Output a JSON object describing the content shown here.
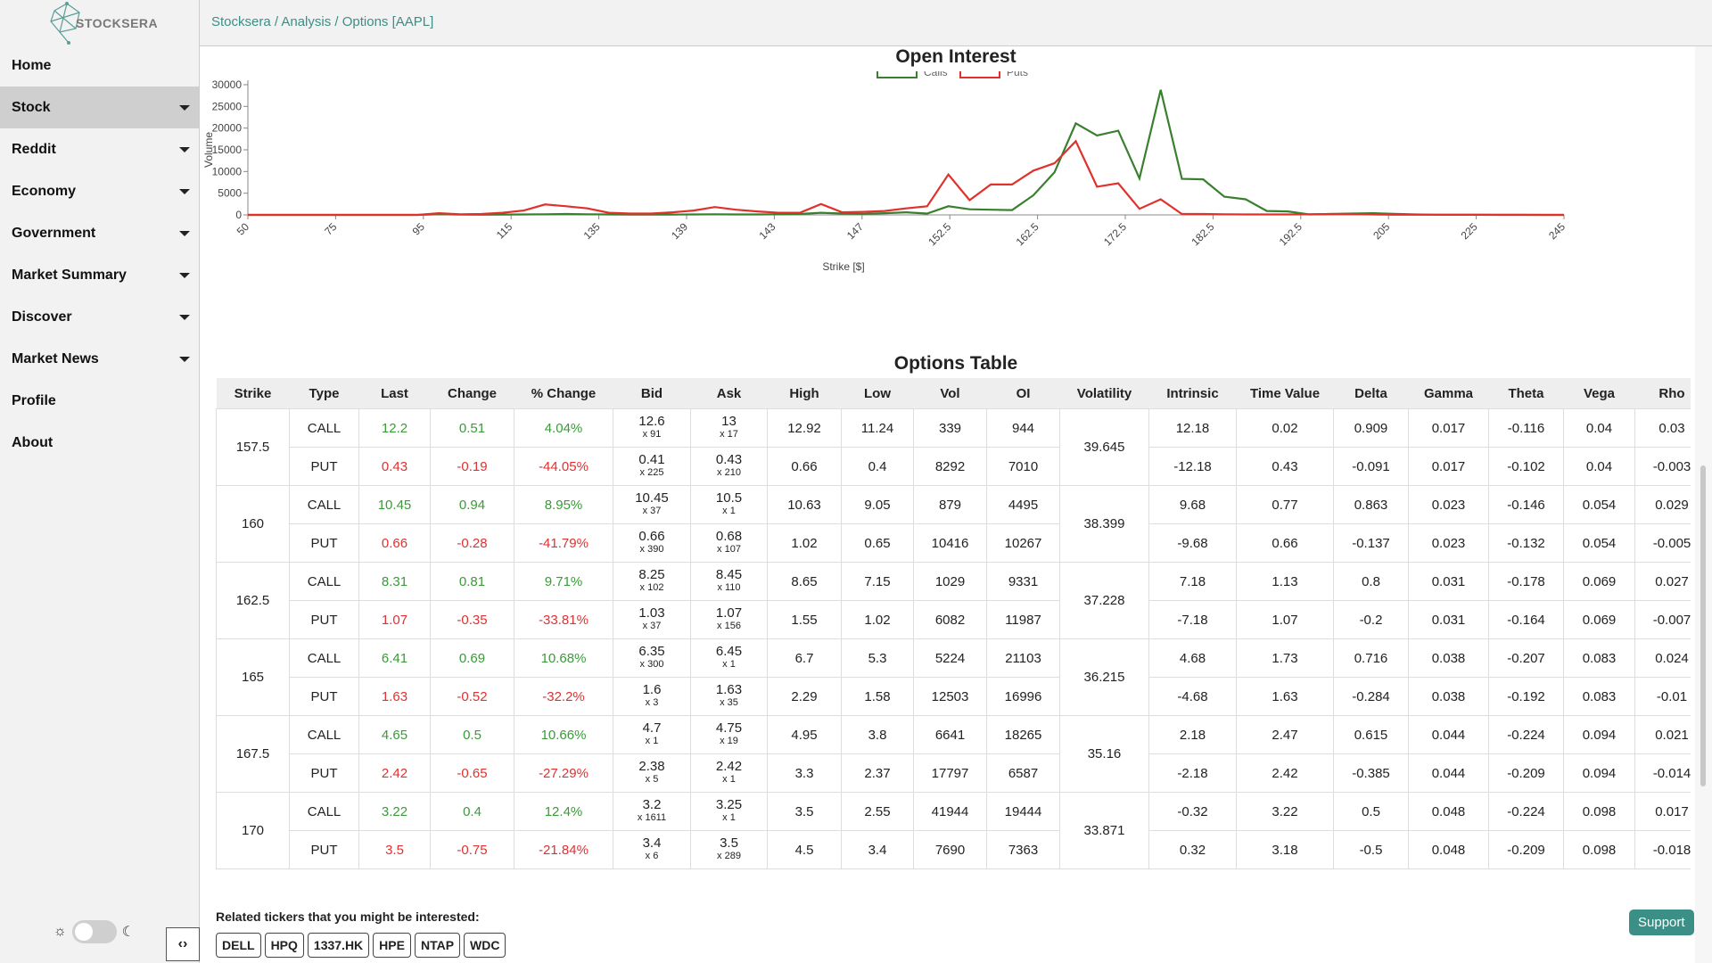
{
  "app": {
    "logo_text": "STOCKSERA",
    "accent_color": "#3a8f87"
  },
  "breadcrumb": "Stocksera / Analysis / Options [AAPL]",
  "nav": [
    {
      "label": "Home",
      "caret": false,
      "active": false
    },
    {
      "label": "Stock",
      "caret": true,
      "active": true
    },
    {
      "label": "Reddit",
      "caret": true,
      "active": false
    },
    {
      "label": "Economy",
      "caret": true,
      "active": false
    },
    {
      "label": "Government",
      "caret": true,
      "active": false
    },
    {
      "label": "Market Summary",
      "caret": true,
      "active": false
    },
    {
      "label": "Discover",
      "caret": true,
      "active": false
    },
    {
      "label": "Market News",
      "caret": true,
      "active": false
    },
    {
      "label": "Profile",
      "caret": false,
      "active": false
    },
    {
      "label": "About",
      "caret": false,
      "active": false
    }
  ],
  "icons": {
    "sun": "☼",
    "moon": "☾",
    "collapse": "‹›"
  },
  "chart": {
    "title": "Open Interest",
    "legend": [
      {
        "label": "Calls",
        "color": "#3a7f2f"
      },
      {
        "label": "Puts",
        "color": "#e0312b"
      }
    ],
    "xlabel": "Strike [$]",
    "ylabel": "Volume",
    "yticks": [
      "0",
      "5000",
      "10000",
      "15000",
      "20000",
      "25000",
      "30000"
    ],
    "xticks": [
      "50",
      "75",
      "95",
      "115",
      "135",
      "139",
      "143",
      "147",
      "152.5",
      "162.5",
      "172.5",
      "182.5",
      "192.5",
      "205",
      "225",
      "245"
    ]
  },
  "chart_data": {
    "type": "line",
    "title": "Open Interest",
    "xlabel": "Strike [$]",
    "ylabel": "Volume",
    "ylim": [
      0,
      30000
    ],
    "x": [
      "50",
      "55",
      "60",
      "65",
      "70",
      "75",
      "80",
      "85",
      "90",
      "95",
      "100",
      "105",
      "110",
      "115",
      "120",
      "125",
      "130",
      "135",
      "136",
      "137",
      "138",
      "139",
      "140",
      "141",
      "142",
      "143",
      "144",
      "145",
      "146",
      "147",
      "148",
      "149",
      "150",
      "152.5",
      "155",
      "157.5",
      "160",
      "162.5",
      "165",
      "167.5",
      "170",
      "172.5",
      "175",
      "177.5",
      "180",
      "182.5",
      "185",
      "187.5",
      "190",
      "192.5",
      "195",
      "197.5",
      "200",
      "205",
      "210",
      "215",
      "220",
      "225",
      "230",
      "235",
      "240",
      "245",
      "250"
    ],
    "series": [
      {
        "name": "Calls",
        "color": "#3a7f2f",
        "values": [
          0,
          0,
          0,
          0,
          0,
          0,
          0,
          0,
          0,
          150,
          80,
          50,
          80,
          100,
          150,
          200,
          150,
          100,
          80,
          80,
          80,
          100,
          150,
          100,
          100,
          150,
          200,
          500,
          300,
          250,
          400,
          600,
          300,
          2000,
          1300,
          1200,
          1100,
          4500,
          9800,
          21100,
          18300,
          19400,
          8400,
          28800,
          8300,
          8200,
          4200,
          3600,
          900,
          800,
          100,
          200,
          300,
          400,
          250,
          100,
          50,
          50,
          50,
          30,
          20,
          10,
          0
        ]
      },
      {
        "name": "Puts",
        "color": "#e0312b",
        "values": [
          0,
          0,
          0,
          0,
          0,
          0,
          0,
          0,
          0,
          400,
          150,
          200,
          500,
          1000,
          2400,
          2000,
          1500,
          500,
          300,
          300,
          600,
          1000,
          1800,
          1200,
          800,
          500,
          500,
          2500,
          600,
          700,
          900,
          1500,
          2000,
          9300,
          3400,
          7000,
          7000,
          10200,
          11900,
          17000,
          6500,
          7300,
          1400,
          3600,
          200,
          200,
          150,
          100,
          100,
          100,
          150,
          200,
          200,
          100,
          50,
          50,
          50,
          30,
          20,
          10,
          5,
          0,
          0
        ]
      }
    ]
  },
  "table": {
    "title": "Options Table",
    "columns": [
      "Strike",
      "Type",
      "Last",
      "Change",
      "% Change",
      "Bid",
      "Ask",
      "High",
      "Low",
      "Vol",
      "OI",
      "Volatility",
      "Intrinsic",
      "Time Value",
      "Delta",
      "Gamma",
      "Theta",
      "Vega",
      "Rho"
    ],
    "groups": [
      {
        "strike": "157.5",
        "volatility": "39.645",
        "rows": [
          {
            "type": "CALL",
            "last": "12.2",
            "change": "0.51",
            "pct": "4.04%",
            "bid": "12.6",
            "bid_size": "x 91",
            "ask": "13",
            "ask_size": "x 17",
            "high": "12.92",
            "low": "11.24",
            "vol": "339",
            "oi": "944",
            "intrinsic": "12.18",
            "time_value": "0.02",
            "delta": "0.909",
            "gamma": "0.017",
            "theta": "-0.116",
            "vega": "0.04",
            "rho": "0.03"
          },
          {
            "type": "PUT",
            "last": "0.43",
            "change": "-0.19",
            "pct": "-44.05%",
            "bid": "0.41",
            "bid_size": "x 225",
            "ask": "0.43",
            "ask_size": "x 210",
            "high": "0.66",
            "low": "0.4",
            "vol": "8292",
            "oi": "7010",
            "intrinsic": "-12.18",
            "time_value": "0.43",
            "delta": "-0.091",
            "gamma": "0.017",
            "theta": "-0.102",
            "vega": "0.04",
            "rho": "-0.003"
          }
        ]
      },
      {
        "strike": "160",
        "volatility": "38.399",
        "rows": [
          {
            "type": "CALL",
            "last": "10.45",
            "change": "0.94",
            "pct": "8.95%",
            "bid": "10.45",
            "bid_size": "x 37",
            "ask": "10.5",
            "ask_size": "x 1",
            "high": "10.63",
            "low": "9.05",
            "vol": "879",
            "oi": "4495",
            "intrinsic": "9.68",
            "time_value": "0.77",
            "delta": "0.863",
            "gamma": "0.023",
            "theta": "-0.146",
            "vega": "0.054",
            "rho": "0.029"
          },
          {
            "type": "PUT",
            "last": "0.66",
            "change": "-0.28",
            "pct": "-41.79%",
            "bid": "0.66",
            "bid_size": "x 390",
            "ask": "0.68",
            "ask_size": "x 107",
            "high": "1.02",
            "low": "0.65",
            "vol": "10416",
            "oi": "10267",
            "intrinsic": "-9.68",
            "time_value": "0.66",
            "delta": "-0.137",
            "gamma": "0.023",
            "theta": "-0.132",
            "vega": "0.054",
            "rho": "-0.005"
          }
        ]
      },
      {
        "strike": "162.5",
        "volatility": "37.228",
        "rows": [
          {
            "type": "CALL",
            "last": "8.31",
            "change": "0.81",
            "pct": "9.71%",
            "bid": "8.25",
            "bid_size": "x 102",
            "ask": "8.45",
            "ask_size": "x 110",
            "high": "8.65",
            "low": "7.15",
            "vol": "1029",
            "oi": "9331",
            "intrinsic": "7.18",
            "time_value": "1.13",
            "delta": "0.8",
            "gamma": "0.031",
            "theta": "-0.178",
            "vega": "0.069",
            "rho": "0.027"
          },
          {
            "type": "PUT",
            "last": "1.07",
            "change": "-0.35",
            "pct": "-33.81%",
            "bid": "1.03",
            "bid_size": "x 37",
            "ask": "1.07",
            "ask_size": "x 156",
            "high": "1.55",
            "low": "1.02",
            "vol": "6082",
            "oi": "11987",
            "intrinsic": "-7.18",
            "time_value": "1.07",
            "delta": "-0.2",
            "gamma": "0.031",
            "theta": "-0.164",
            "vega": "0.069",
            "rho": "-0.007"
          }
        ]
      },
      {
        "strike": "165",
        "volatility": "36.215",
        "rows": [
          {
            "type": "CALL",
            "last": "6.41",
            "change": "0.69",
            "pct": "10.68%",
            "bid": "6.35",
            "bid_size": "x 300",
            "ask": "6.45",
            "ask_size": "x 1",
            "high": "6.7",
            "low": "5.3",
            "vol": "5224",
            "oi": "21103",
            "intrinsic": "4.68",
            "time_value": "1.73",
            "delta": "0.716",
            "gamma": "0.038",
            "theta": "-0.207",
            "vega": "0.083",
            "rho": "0.024"
          },
          {
            "type": "PUT",
            "last": "1.63",
            "change": "-0.52",
            "pct": "-32.2%",
            "bid": "1.6",
            "bid_size": "x 3",
            "ask": "1.63",
            "ask_size": "x 35",
            "high": "2.29",
            "low": "1.58",
            "vol": "12503",
            "oi": "16996",
            "intrinsic": "-4.68",
            "time_value": "1.63",
            "delta": "-0.284",
            "gamma": "0.038",
            "theta": "-0.192",
            "vega": "0.083",
            "rho": "-0.01"
          }
        ]
      },
      {
        "strike": "167.5",
        "volatility": "35.16",
        "rows": [
          {
            "type": "CALL",
            "last": "4.65",
            "change": "0.5",
            "pct": "10.66%",
            "bid": "4.7",
            "bid_size": "x 1",
            "ask": "4.75",
            "ask_size": "x 19",
            "high": "4.95",
            "low": "3.8",
            "vol": "6641",
            "oi": "18265",
            "intrinsic": "2.18",
            "time_value": "2.47",
            "delta": "0.615",
            "gamma": "0.044",
            "theta": "-0.224",
            "vega": "0.094",
            "rho": "0.021"
          },
          {
            "type": "PUT",
            "last": "2.42",
            "change": "-0.65",
            "pct": "-27.29%",
            "bid": "2.38",
            "bid_size": "x 5",
            "ask": "2.42",
            "ask_size": "x 1",
            "high": "3.3",
            "low": "2.37",
            "vol": "17797",
            "oi": "6587",
            "intrinsic": "-2.18",
            "time_value": "2.42",
            "delta": "-0.385",
            "gamma": "0.044",
            "theta": "-0.209",
            "vega": "0.094",
            "rho": "-0.014"
          }
        ]
      },
      {
        "strike": "170",
        "volatility": "33.871",
        "rows": [
          {
            "type": "CALL",
            "last": "3.22",
            "change": "0.4",
            "pct": "12.4%",
            "bid": "3.2",
            "bid_size": "x 1611",
            "ask": "3.25",
            "ask_size": "x 1",
            "high": "3.5",
            "low": "2.55",
            "vol": "41944",
            "oi": "19444",
            "intrinsic": "-0.32",
            "time_value": "3.22",
            "delta": "0.5",
            "gamma": "0.048",
            "theta": "-0.224",
            "vega": "0.098",
            "rho": "0.017"
          },
          {
            "type": "PUT",
            "last": "3.5",
            "change": "-0.75",
            "pct": "-21.84%",
            "bid": "3.4",
            "bid_size": "x 6",
            "ask": "3.5",
            "ask_size": "x 289",
            "high": "4.5",
            "low": "3.4",
            "vol": "7690",
            "oi": "7363",
            "intrinsic": "0.32",
            "time_value": "3.18",
            "delta": "-0.5",
            "gamma": "0.048",
            "theta": "-0.209",
            "vega": "0.098",
            "rho": "-0.018"
          }
        ]
      }
    ]
  },
  "related": {
    "label": "Related tickers that you might be interested:",
    "tickers": [
      "DELL",
      "HPQ",
      "1337.HK",
      "HPE",
      "NTAP",
      "WDC"
    ]
  },
  "support_label": "Support"
}
